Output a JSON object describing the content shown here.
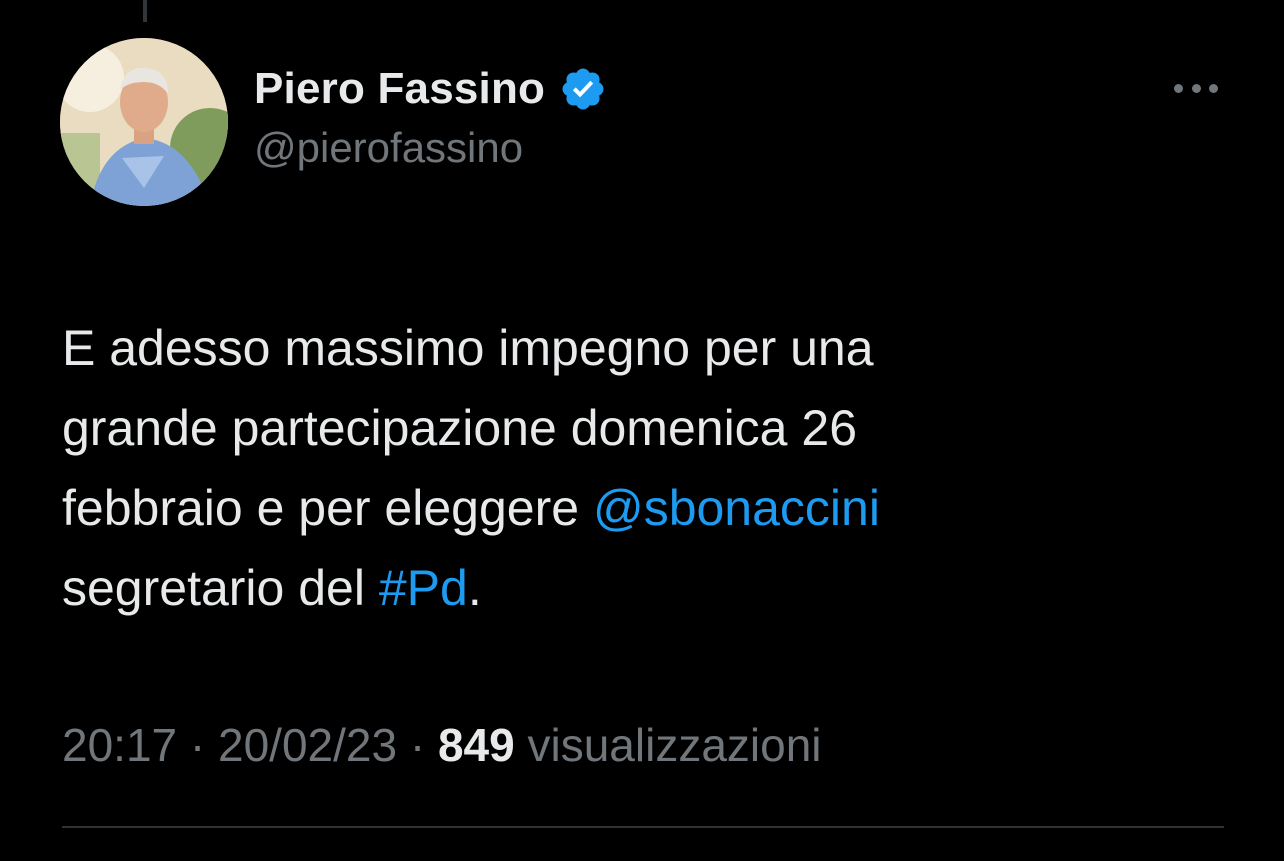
{
  "tweet": {
    "author": {
      "display_name": "Piero Fassino",
      "handle": "@pierofassino",
      "verified_icon": "verified-badge-icon",
      "verified_color": "#1d9bf0"
    },
    "text_lines": [
      {
        "plain": "E adesso massimo impegno per una"
      },
      {
        "plain": "grande partecipazione domenica 26"
      },
      {
        "plain": "febbraio e per eleggere ",
        "mention": "@sbonaccini"
      },
      {
        "plain": "segretario del ",
        "hashtag": "#Pd",
        "trailing": "."
      }
    ],
    "time": "20:17",
    "separator": "·",
    "date": "20/02/23",
    "views_count": "849",
    "views_label": "visualizzazioni",
    "more_icon": "more-options-icon"
  },
  "colors": {
    "background": "#000000",
    "text_primary": "#e7e9ea",
    "text_secondary": "#71767b",
    "link": "#1d9bf0",
    "divider": "#2f3336"
  }
}
